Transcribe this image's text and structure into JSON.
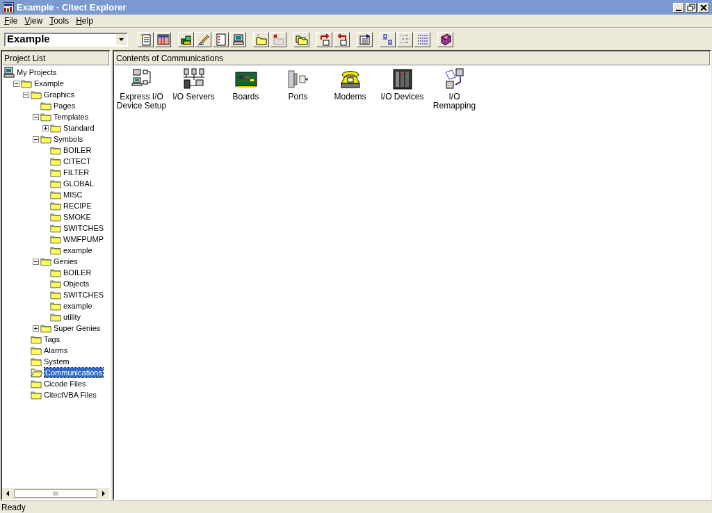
{
  "window": {
    "title": "Example - Citect Explorer"
  },
  "menu": [
    "File",
    "View",
    "Tools",
    "Help"
  ],
  "project_combo": {
    "value": "Example"
  },
  "left_pane": {
    "header": "Project List",
    "tree": [
      {
        "label": "My Projects",
        "kind": "computer",
        "selected": false,
        "children": [
          {
            "label": "Example",
            "kind": "folder",
            "expanded": true,
            "selected": false,
            "children": [
              {
                "label": "Graphics",
                "kind": "folder",
                "expanded": true,
                "selected": false,
                "children": [
                  {
                    "label": "Pages",
                    "kind": "folder",
                    "selected": false
                  },
                  {
                    "label": "Templates",
                    "kind": "folder",
                    "expanded": true,
                    "selected": false,
                    "children": [
                      {
                        "label": "Standard",
                        "kind": "folder",
                        "expanded": false,
                        "selected": false
                      }
                    ]
                  },
                  {
                    "label": "Symbols",
                    "kind": "folder",
                    "expanded": true,
                    "selected": false,
                    "children": [
                      {
                        "label": "BOILER",
                        "kind": "folder",
                        "selected": false
                      },
                      {
                        "label": "CITECT",
                        "kind": "folder",
                        "selected": false
                      },
                      {
                        "label": "FILTER",
                        "kind": "folder",
                        "selected": false
                      },
                      {
                        "label": "GLOBAL",
                        "kind": "folder",
                        "selected": false
                      },
                      {
                        "label": "MISC",
                        "kind": "folder",
                        "selected": false
                      },
                      {
                        "label": "RECIPE",
                        "kind": "folder",
                        "selected": false
                      },
                      {
                        "label": "SMOKE",
                        "kind": "folder",
                        "selected": false
                      },
                      {
                        "label": "SWITCHES",
                        "kind": "folder",
                        "selected": false
                      },
                      {
                        "label": "WMFPUMP",
                        "kind": "folder",
                        "selected": false
                      },
                      {
                        "label": "example",
                        "kind": "folder",
                        "selected": false
                      }
                    ]
                  },
                  {
                    "label": "Genies",
                    "kind": "folder",
                    "expanded": true,
                    "selected": false,
                    "children": [
                      {
                        "label": "BOILER",
                        "kind": "folder",
                        "selected": false
                      },
                      {
                        "label": "Objects",
                        "kind": "folder",
                        "selected": false
                      },
                      {
                        "label": "SWITCHES",
                        "kind": "folder",
                        "selected": false
                      },
                      {
                        "label": "example",
                        "kind": "folder",
                        "selected": false
                      },
                      {
                        "label": "utility",
                        "kind": "folder",
                        "selected": false
                      }
                    ]
                  },
                  {
                    "label": "Super Genies",
                    "kind": "folder",
                    "expanded": false,
                    "selected": false
                  }
                ]
              },
              {
                "label": "Tags",
                "kind": "folder",
                "selected": false
              },
              {
                "label": "Alarms",
                "kind": "folder",
                "selected": false
              },
              {
                "label": "System",
                "kind": "folder",
                "selected": false
              },
              {
                "label": "Communications",
                "kind": "folder",
                "selected": true
              },
              {
                "label": "Cicode Files",
                "kind": "folder",
                "selected": false
              },
              {
                "label": "CitectVBA Files",
                "kind": "folder",
                "selected": false
              }
            ]
          }
        ]
      }
    ]
  },
  "right_pane": {
    "header": "Contents of Communications",
    "items": [
      {
        "label": "Express I/O Device Setup",
        "kind": "express"
      },
      {
        "label": "I/O Servers",
        "kind": "servers"
      },
      {
        "label": "Boards",
        "kind": "board"
      },
      {
        "label": "Ports",
        "kind": "port"
      },
      {
        "label": "Modems",
        "kind": "modem"
      },
      {
        "label": "I/O Devices",
        "kind": "device"
      },
      {
        "label": "I/O Remapping",
        "kind": "remap"
      }
    ]
  },
  "status_bar": "Ready"
}
